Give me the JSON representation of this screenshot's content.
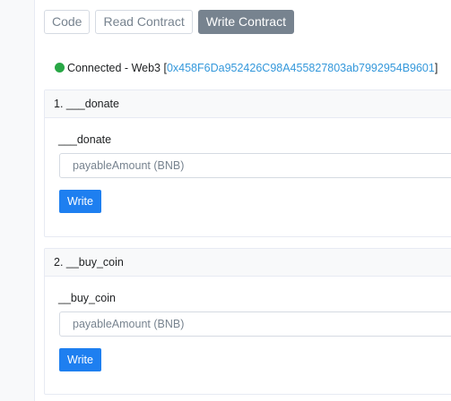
{
  "tabs": [
    {
      "label": "Code",
      "active": false
    },
    {
      "label": "Read Contract",
      "active": false
    },
    {
      "label": "Write Contract",
      "active": true
    }
  ],
  "connection": {
    "status_text": "Connected - Web3 [",
    "address": "0x458F6Da952426C98A455827803ab7992954B9601",
    "close_bracket": "]",
    "status_color": "#28a745"
  },
  "functions": [
    {
      "header": "1. ___donate",
      "param_label": "___donate",
      "placeholder": "payableAmount (BNB)",
      "value": "",
      "button_label": "Write"
    },
    {
      "header": "2. __buy_coin",
      "param_label": "__buy_coin",
      "placeholder": "payableAmount (BNB)",
      "value": "",
      "button_label": "Write"
    }
  ],
  "colors": {
    "accent": "#1e7ff0",
    "active_tab": "#77838f",
    "link": "#3498db"
  }
}
